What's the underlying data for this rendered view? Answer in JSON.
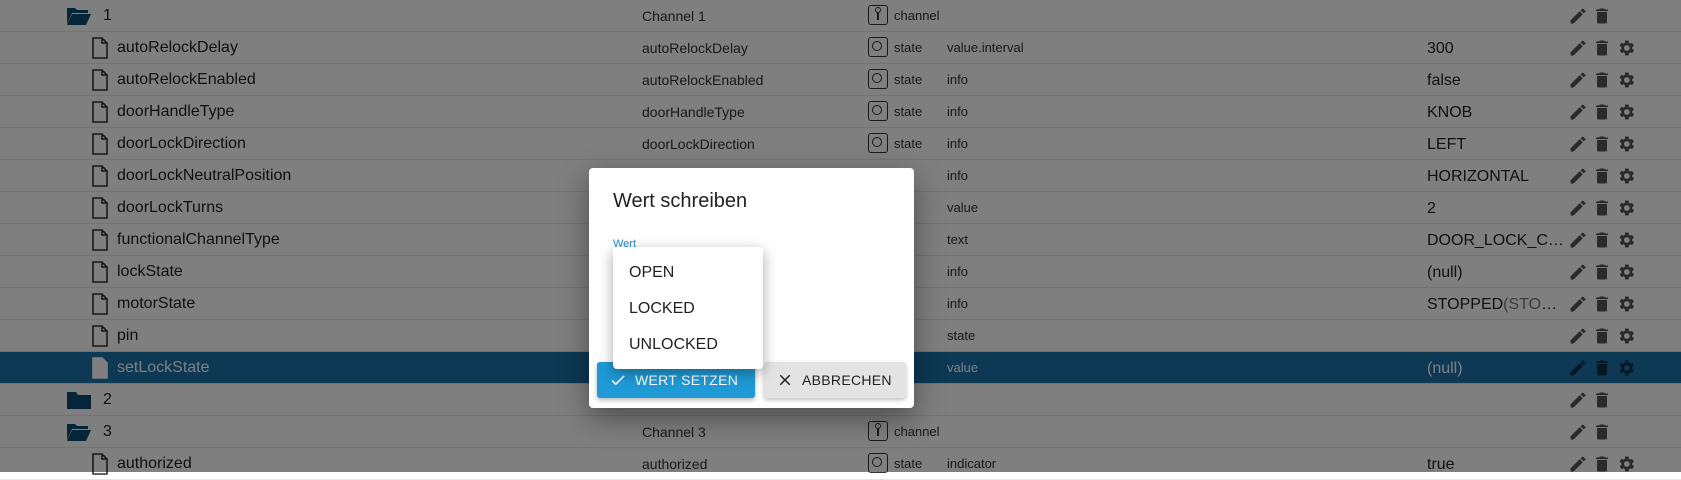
{
  "tree": {
    "rows": [
      {
        "kind": "folder-open",
        "level": 0,
        "name": "1",
        "id": "Channel 1",
        "type": "channel",
        "role": "",
        "value": "",
        "actions": [
          "edit",
          "delete"
        ]
      },
      {
        "kind": "file",
        "level": 1,
        "name": "autoRelockDelay",
        "id": "autoRelockDelay",
        "type": "state",
        "role": "value.interval",
        "value": "300",
        "actions": [
          "edit",
          "delete",
          "settings"
        ]
      },
      {
        "kind": "file",
        "level": 1,
        "name": "autoRelockEnabled",
        "id": "autoRelockEnabled",
        "type": "state",
        "role": "info",
        "value": "false",
        "actions": [
          "edit",
          "delete",
          "settings"
        ]
      },
      {
        "kind": "file",
        "level": 1,
        "name": "doorHandleType",
        "id": "doorHandleType",
        "type": "state",
        "role": "info",
        "value": "KNOB",
        "actions": [
          "edit",
          "delete",
          "settings"
        ]
      },
      {
        "kind": "file",
        "level": 1,
        "name": "doorLockDirection",
        "id": "doorLockDirection",
        "type": "state",
        "role": "info",
        "value": "LEFT",
        "actions": [
          "edit",
          "delete",
          "settings"
        ]
      },
      {
        "kind": "file",
        "level": 1,
        "name": "doorLockNeutralPosition",
        "id": "",
        "type": "",
        "role": "info",
        "value": "HORIZONTAL",
        "actions": [
          "edit",
          "delete",
          "settings"
        ]
      },
      {
        "kind": "file",
        "level": 1,
        "name": "doorLockTurns",
        "id": "",
        "type": "",
        "role": "value",
        "value": "2",
        "actions": [
          "edit",
          "delete",
          "settings"
        ]
      },
      {
        "kind": "file",
        "level": 1,
        "name": "functionalChannelType",
        "id": "",
        "type": "",
        "role": "text",
        "value": "DOOR_LOCK_CHA…",
        "actions": [
          "edit",
          "delete",
          "settings"
        ]
      },
      {
        "kind": "file",
        "level": 1,
        "name": "lockState",
        "id": "",
        "type": "",
        "role": "info",
        "value": "(null)",
        "actions": [
          "edit",
          "delete",
          "settings"
        ]
      },
      {
        "kind": "file",
        "level": 1,
        "name": "motorState",
        "id": "",
        "type": "",
        "role": "info",
        "value": "STOPPED",
        "value_sub": "(STOPPE…",
        "actions": [
          "edit",
          "delete",
          "settings"
        ]
      },
      {
        "kind": "file",
        "level": 1,
        "name": "pin",
        "id": "",
        "type": "",
        "role": "state",
        "value": "",
        "actions": [
          "edit",
          "delete",
          "settings"
        ]
      },
      {
        "kind": "file",
        "level": 1,
        "name": "setLockState",
        "id": "",
        "type": "",
        "role": "value",
        "value": "(null)",
        "selected": true,
        "actions": [
          "edit",
          "delete",
          "settings"
        ]
      },
      {
        "kind": "folder",
        "level": 0,
        "name": "2",
        "id": "",
        "type": "",
        "role": "",
        "value": "",
        "actions": [
          "edit",
          "delete"
        ]
      },
      {
        "kind": "folder-open",
        "level": 0,
        "name": "3",
        "id": "Channel 3",
        "type": "channel",
        "role": "",
        "value": "",
        "actions": [
          "edit",
          "delete"
        ]
      },
      {
        "kind": "file",
        "level": 1,
        "name": "authorized",
        "id": "authorized",
        "type": "state",
        "role": "indicator",
        "value": "true",
        "actions": [
          "edit",
          "delete",
          "settings"
        ]
      }
    ]
  },
  "dialog": {
    "title": "Wert schreiben",
    "field_label": "Wert",
    "confirm_label": "WERT SETZEN",
    "cancel_label": "ABBRECHEN"
  },
  "dropdown": {
    "options": [
      "OPEN",
      "LOCKED",
      "UNLOCKED"
    ]
  },
  "colors": {
    "selected_row": "#1a73a8",
    "primary_button": "#1f9ad6",
    "overlay": "rgba(0,0,0,0.5)"
  }
}
